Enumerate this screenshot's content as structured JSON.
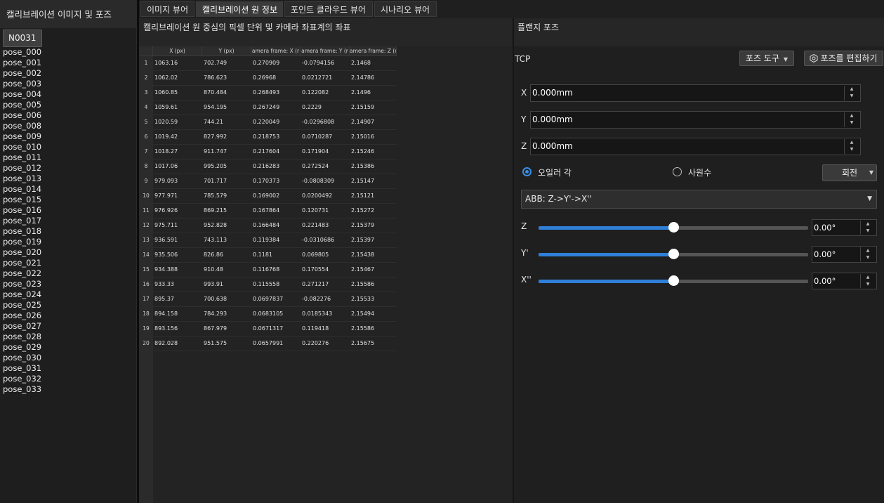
{
  "left_panel": {
    "title": "캘리브레이션 이미지 및 포즈",
    "group": "N0031",
    "poses": [
      "pose_000",
      "pose_001",
      "pose_002",
      "pose_003",
      "pose_004",
      "pose_005",
      "pose_006",
      "pose_008",
      "pose_009",
      "pose_010",
      "pose_011",
      "pose_012",
      "pose_013",
      "pose_014",
      "pose_015",
      "pose_016",
      "pose_017",
      "pose_018",
      "pose_019",
      "pose_020",
      "pose_021",
      "pose_022",
      "pose_023",
      "pose_024",
      "pose_025",
      "pose_026",
      "pose_027",
      "pose_028",
      "pose_029",
      "pose_030",
      "pose_031",
      "pose_032",
      "pose_033"
    ]
  },
  "tabs": [
    {
      "label": "이미지 뷰어",
      "active": false
    },
    {
      "label": "캘리브레이션 원 정보",
      "active": true
    },
    {
      "label": "포인트 클라우드 뷰어",
      "active": false
    },
    {
      "label": "시나리오 뷰어",
      "active": false
    }
  ],
  "circle_info": {
    "title": "캘리브레이션 원 중심의 픽셀 단위 및 카메라 좌표계의 좌표",
    "columns": [
      "X (px)",
      "Y (px)",
      "amera frame: X (r",
      "amera frame: Y (r",
      "amera frame: Z (r"
    ],
    "rows": [
      [
        "1",
        "1063.16",
        "702.749",
        "0.270909",
        "-0.0794156",
        "2.1468"
      ],
      [
        "2",
        "1062.02",
        "786.623",
        "0.26968",
        "0.0212721",
        "2.14786"
      ],
      [
        "3",
        "1060.85",
        "870.484",
        "0.268493",
        "0.122082",
        "2.1496"
      ],
      [
        "4",
        "1059.61",
        "954.195",
        "0.267249",
        "0.2229",
        "2.15159"
      ],
      [
        "5",
        "1020.59",
        "744.21",
        "0.220049",
        "-0.0296808",
        "2.14907"
      ],
      [
        "6",
        "1019.42",
        "827.992",
        "0.218753",
        "0.0710287",
        "2.15016"
      ],
      [
        "7",
        "1018.27",
        "911.747",
        "0.217604",
        "0.171904",
        "2.15246"
      ],
      [
        "8",
        "1017.06",
        "995.205",
        "0.216283",
        "0.272524",
        "2.15386"
      ],
      [
        "9",
        "979.093",
        "701.717",
        "0.170373",
        "-0.0808309",
        "2.15147"
      ],
      [
        "10",
        "977.971",
        "785.579",
        "0.169002",
        "0.0200492",
        "2.15121"
      ],
      [
        "11",
        "976.926",
        "869.215",
        "0.167864",
        "0.120731",
        "2.15272"
      ],
      [
        "12",
        "975.711",
        "952.828",
        "0.166484",
        "0.221483",
        "2.15379"
      ],
      [
        "13",
        "936.591",
        "743.113",
        "0.119384",
        "-0.0310686",
        "2.15397"
      ],
      [
        "14",
        "935.506",
        "826.86",
        "0.1181",
        "0.069805",
        "2.15438"
      ],
      [
        "15",
        "934.388",
        "910.48",
        "0.116768",
        "0.170554",
        "2.15467"
      ],
      [
        "16",
        "933.33",
        "993.91",
        "0.115558",
        "0.271217",
        "2.15586"
      ],
      [
        "17",
        "895.37",
        "700.638",
        "0.0697837",
        "-0.082276",
        "2.15533"
      ],
      [
        "18",
        "894.158",
        "784.293",
        "0.0683105",
        "0.0185343",
        "2.15494"
      ],
      [
        "19",
        "893.156",
        "867.979",
        "0.0671317",
        "0.119418",
        "2.15586"
      ],
      [
        "20",
        "892.028",
        "951.575",
        "0.0657991",
        "0.220276",
        "2.15675"
      ]
    ]
  },
  "flange_pose": {
    "title": "플랜지 포즈",
    "tcp_label": "TCP",
    "pose_tool_label": "포즈 도구",
    "edit_pose_label": "포즈를 편집하기",
    "x_label": "X",
    "x_value": "0.000mm",
    "y_label": "Y",
    "y_value": "0.000mm",
    "z_label": "Z",
    "z_value": "0.000mm",
    "euler_label": "오일러 각",
    "quaternion_label": "사원수",
    "euler_selected": true,
    "rotate_label": "회전",
    "convention": "ABB: Z->Y'->X''",
    "sliders": [
      {
        "label": "Z",
        "value": "0.00°",
        "level": 0.5
      },
      {
        "label": "Y'",
        "value": "0.00°",
        "level": 0.5
      },
      {
        "label": "X''",
        "value": "0.00°",
        "level": 0.5
      }
    ]
  },
  "colors": {
    "accent": "#2f7fd8",
    "background": "#202020"
  }
}
